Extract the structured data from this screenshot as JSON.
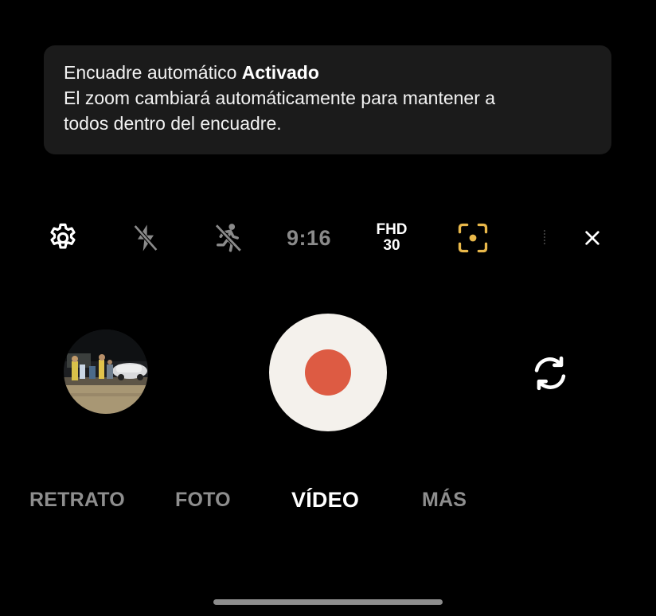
{
  "toast": {
    "line1_prefix": "Encuadre automático",
    "line1_status": "Activado",
    "line2": "El zoom cambiará automáticamente para mantener a",
    "line3": "todos dentro del encuadre."
  },
  "toolbar": {
    "settings_icon": "gear-icon",
    "flash_icon": "flash-off-icon",
    "motion_icon": "motion-photo-off-icon",
    "aspect_ratio": "9:16",
    "resolution": "FHD",
    "fps": "30",
    "autoframe_icon": "auto-framing-icon",
    "close_icon": "close-icon"
  },
  "controls": {
    "gallery_thumbnail": "gallery-thumbnail",
    "shutter": "record-button",
    "switch_camera_icon": "switch-camera-icon"
  },
  "modes": {
    "portrait": "RETRATO",
    "photo": "FOTO",
    "video": "VÍDEO",
    "more": "MÁS",
    "active": "VÍDEO"
  },
  "colors": {
    "record": "#dd5b43",
    "shutter_ring": "#f4f1ec",
    "autoframe_accent": "#e9b84a",
    "toast_bg": "#1b1b1b"
  }
}
